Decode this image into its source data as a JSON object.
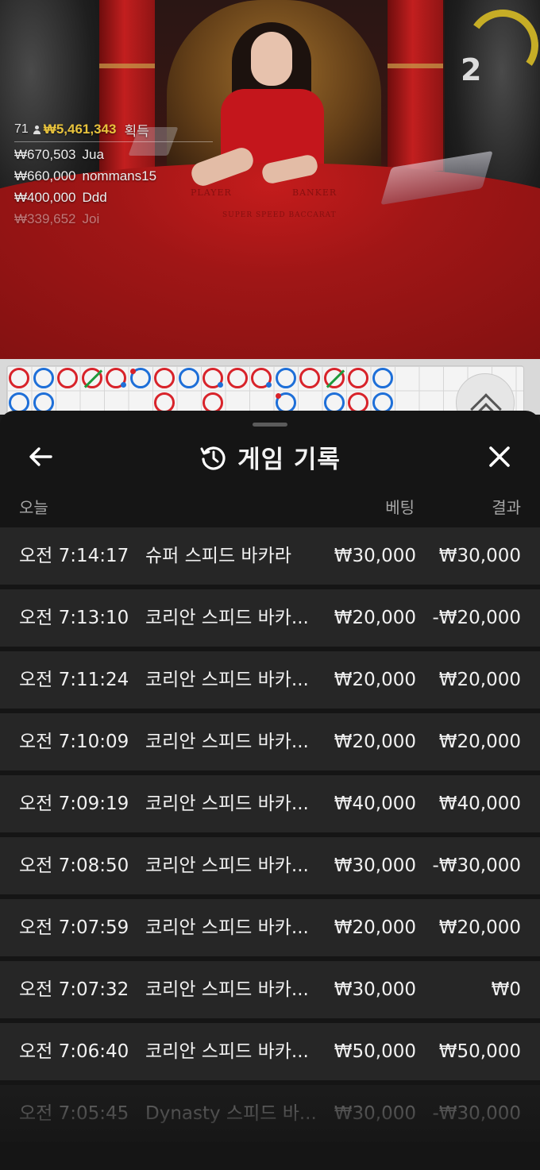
{
  "video": {
    "countdown": "2",
    "winners": {
      "count": "71",
      "total": "₩5,461,343",
      "earned_label": "획득",
      "rows": [
        {
          "amount": "₩670,503",
          "name": "Jua"
        },
        {
          "amount": "₩660,000",
          "name": "nommans15"
        },
        {
          "amount": "₩400,000",
          "name": "Ddd"
        },
        {
          "amount": "₩339,652",
          "name": "Joi"
        }
      ]
    },
    "table_labels": {
      "player": "PLAYER",
      "banker": "BANKER",
      "game": "SUPER SPEED BACCARAT"
    }
  },
  "roadmap": {
    "colors": {
      "banker": "#d8232a",
      "player": "#1e6fd8",
      "tie": "#1e9a3c"
    }
  },
  "panel": {
    "title": "게임 기록",
    "icons": {
      "back": "arrow-left-icon",
      "history": "history-clock-icon",
      "close": "close-icon"
    },
    "columns": {
      "date": "오늘",
      "bet": "베팅",
      "result": "결과"
    },
    "rows": [
      {
        "time": "오전 7:14:17",
        "game": "슈퍼 스피드 바카라",
        "bet": "₩30,000",
        "result": "₩30,000"
      },
      {
        "time": "오전 7:13:10",
        "game": "코리안 스피드 바카...",
        "bet": "₩20,000",
        "result": "-₩20,000"
      },
      {
        "time": "오전 7:11:24",
        "game": "코리안 스피드 바카...",
        "bet": "₩20,000",
        "result": "₩20,000"
      },
      {
        "time": "오전 7:10:09",
        "game": "코리안 스피드 바카...",
        "bet": "₩20,000",
        "result": "₩20,000"
      },
      {
        "time": "오전 7:09:19",
        "game": "코리안 스피드 바카...",
        "bet": "₩40,000",
        "result": "₩40,000"
      },
      {
        "time": "오전 7:08:50",
        "game": "코리안 스피드 바카...",
        "bet": "₩30,000",
        "result": "-₩30,000"
      },
      {
        "time": "오전 7:07:59",
        "game": "코리안 스피드 바카...",
        "bet": "₩20,000",
        "result": "₩20,000"
      },
      {
        "time": "오전 7:07:32",
        "game": "코리안 스피드 바카...",
        "bet": "₩30,000",
        "result": "₩0"
      },
      {
        "time": "오전 7:06:40",
        "game": "코리안 스피드 바카...",
        "bet": "₩50,000",
        "result": "₩50,000"
      },
      {
        "time": "오전 7:05:45",
        "game": "Dynasty 스피드 바...",
        "bet": "₩30,000",
        "result": "-₩30,000"
      }
    ]
  }
}
